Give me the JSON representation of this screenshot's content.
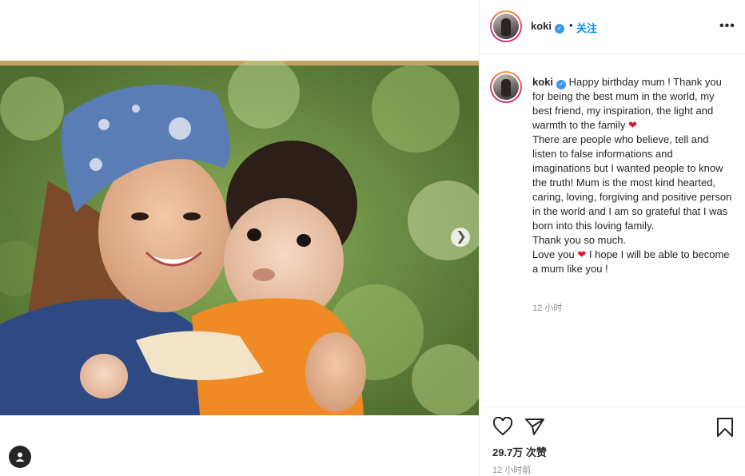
{
  "post": {
    "username": "koki",
    "dot": "•",
    "follow_label": "关注",
    "more_label": "•••",
    "caption_lines": [
      {
        "text": "Happy birthday mum ! Thank you for being the best mum in the world, my best friend, my inspiration, the light and warmth to the family ",
        "emoji": "❤"
      },
      {
        "text": "There are people who believe, tell and listen to false informations and imaginations but I wanted people to know the truth! Mum is the most kind hearted, caring, loving, forgiving and positive person in the world and I am so grateful that I was born into this loving family."
      },
      {
        "text": "Thank you so much."
      },
      {
        "text": "Love you ",
        "emoji": "❤",
        "after": " I hope I will be able to become a mum like you !"
      }
    ],
    "caption_time": "12 小时",
    "likes": "29.7万 次赞",
    "posted_time": "12 小时前"
  },
  "icons": {
    "next": "chevron-right-icon",
    "verified": "verified-badge-icon",
    "like": "heart-icon",
    "share": "paper-plane-icon",
    "save": "bookmark-icon",
    "user": "user-icon"
  },
  "colors": {
    "link": "#0095f6",
    "verified": "#3897f0",
    "muted": "#8e8e8e",
    "heart": "#e0142a"
  }
}
